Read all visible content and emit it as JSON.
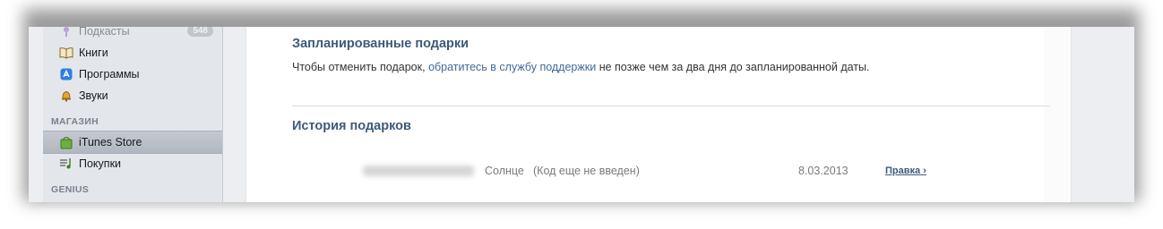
{
  "sidebar": {
    "items": [
      {
        "label": "Подкасты",
        "badge": "548",
        "icon": "podcast-icon"
      },
      {
        "label": "Книги",
        "icon": "book-icon"
      },
      {
        "label": "Программы",
        "icon": "apps-icon"
      },
      {
        "label": "Звуки",
        "icon": "bell-icon"
      }
    ],
    "section_store": "МАГАЗИН",
    "store_items": [
      {
        "label": "iTunes Store",
        "icon": "store-bag-icon"
      },
      {
        "label": "Покупки",
        "icon": "purchases-icon"
      }
    ],
    "section_genius": "GENIUS"
  },
  "main": {
    "scheduled_title": "Запланированные подарки",
    "scheduled_text_before": "Чтобы отменить подарок,",
    "scheduled_link": "обратитесь в службу поддержки",
    "scheduled_text_after": "не позже чем за два дня до запланированной даты.",
    "history_title": "История подарков",
    "history_rows": [
      {
        "recipient": "Солнце",
        "status": "(Код еще не введен)",
        "date": "8.03.2013",
        "action": "Правка",
        "action_chevron": "›"
      }
    ]
  }
}
